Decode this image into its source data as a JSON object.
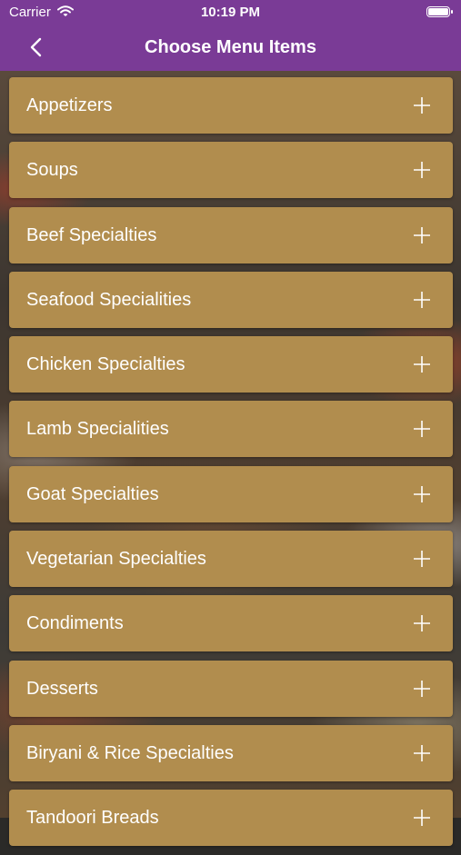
{
  "status_bar": {
    "carrier": "Carrier",
    "time": "10:19 PM"
  },
  "nav": {
    "title": "Choose Menu Items",
    "back_icon": "chevron-left-icon"
  },
  "colors": {
    "header": "#7a3b96",
    "item_background": "#b18d4e",
    "text": "#ffffff"
  },
  "menu": {
    "items": [
      {
        "label": "Appetizers"
      },
      {
        "label": "Soups"
      },
      {
        "label": "Beef Specialties"
      },
      {
        "label": "Seafood Specialities"
      },
      {
        "label": "Chicken Specialties"
      },
      {
        "label": "Lamb Specialities"
      },
      {
        "label": "Goat Specialties"
      },
      {
        "label": "Vegetarian Specialties"
      },
      {
        "label": "Condiments"
      },
      {
        "label": "Desserts"
      },
      {
        "label": "Biryani & Rice Specialties"
      },
      {
        "label": "Tandoori Breads"
      }
    ],
    "expand_icon": "plus-icon"
  }
}
